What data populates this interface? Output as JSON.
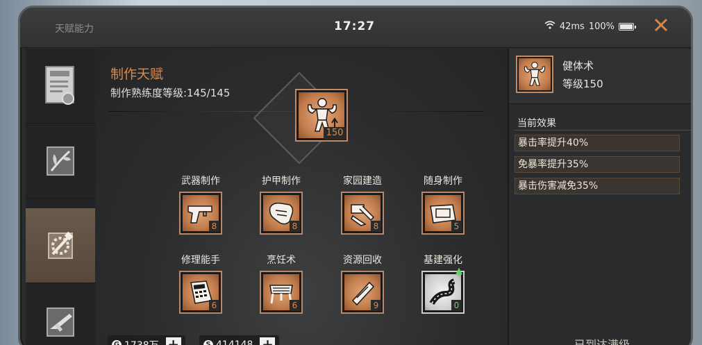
{
  "status_bar": {
    "screen_title": "天赋能力",
    "time": "17:27",
    "network": "42ms",
    "battery": "100%"
  },
  "sidebar": {
    "tabs": [
      {
        "name": "trade-certificate",
        "active": false
      },
      {
        "name": "herb-plant",
        "active": false
      },
      {
        "name": "crafting-gear-hammer",
        "active": true
      },
      {
        "name": "weapon-smg",
        "active": false
      }
    ]
  },
  "main": {
    "title": "制作天赋",
    "proficiency_label": "制作熟练度等级:145/145",
    "top_skill": {
      "icon": "bodybuilder-icon",
      "level": "150"
    },
    "skills": [
      {
        "label": "武器制作",
        "icon": "pistol-icon",
        "level": "8"
      },
      {
        "label": "护甲制作",
        "icon": "armor-glove-icon",
        "level": "8"
      },
      {
        "label": "家园建造",
        "icon": "construction-icon",
        "level": "8"
      },
      {
        "label": "随身制作",
        "icon": "toolbox-icon",
        "level": "5"
      },
      {
        "label": "修理能手",
        "icon": "calculator-icon",
        "level": "6"
      },
      {
        "label": "烹饪术",
        "icon": "grill-icon",
        "level": "6"
      },
      {
        "label": "资源回收",
        "icon": "recycle-tool-icon",
        "level": "9"
      },
      {
        "label": "基建强化",
        "icon": "road-icon",
        "level": "0"
      }
    ],
    "currency": [
      {
        "icon": "gold-coin-icon",
        "symbol": "G",
        "value": "1738万"
      },
      {
        "icon": "silver-coin-icon",
        "symbol": "S",
        "value": "414148"
      }
    ]
  },
  "detail": {
    "name": "健体术",
    "level": "等级150",
    "effects_title": "当前效果",
    "effects": [
      "暴击率提升40%",
      "免暴率提升35%",
      "暴击伤害减免35%"
    ],
    "footer": "已到达满级"
  },
  "colors": {
    "accent": "#d98a4e",
    "skill_bg": "#c27c4c",
    "sidebar_active": "#6a5a4c",
    "upgrade_green": "#5ed46a"
  }
}
